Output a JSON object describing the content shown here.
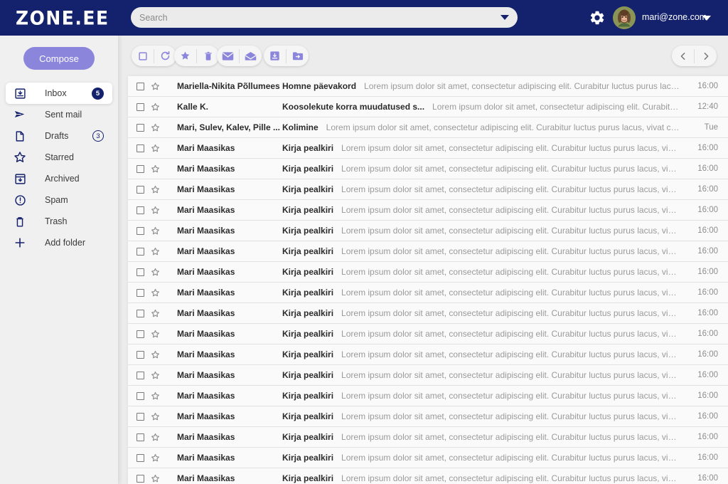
{
  "brand": {
    "logo_text": "ZONE.EE",
    "navy": "#14216d",
    "purple": "#8b85dc"
  },
  "search": {
    "placeholder": "Search",
    "value": "",
    "dropdown_icon": "chevron-down-icon"
  },
  "account": {
    "gear_icon": "gear-icon",
    "avatar_icon": "user-avatar",
    "email": "mari@zone.com",
    "caret_icon": "chevron-down-icon"
  },
  "sidebar": {
    "compose_label": "Compose",
    "items": [
      {
        "label": "Inbox",
        "icon": "inbox-icon",
        "badge": "5",
        "badge_style": "filled",
        "active": true
      },
      {
        "label": "Sent mail",
        "icon": "send-icon",
        "badge": "",
        "badge_style": "none",
        "active": false
      },
      {
        "label": "Drafts",
        "icon": "document-icon",
        "badge": "3",
        "badge_style": "outline",
        "active": false
      },
      {
        "label": "Starred",
        "icon": "star-icon",
        "badge": "",
        "badge_style": "none",
        "active": false
      },
      {
        "label": "Archived",
        "icon": "archive-icon",
        "badge": "",
        "badge_style": "none",
        "active": false
      },
      {
        "label": "Spam",
        "icon": "alert-icon",
        "badge": "",
        "badge_style": "none",
        "active": false
      },
      {
        "label": "Trash",
        "icon": "trash-icon",
        "badge": "",
        "badge_style": "none",
        "active": false
      },
      {
        "label": "Add folder",
        "icon": "plus-icon",
        "badge": "",
        "badge_style": "none",
        "active": false
      }
    ]
  },
  "toolbar": {
    "groups": [
      {
        "name": "selection-group",
        "buttons": [
          {
            "icon": "checkbox-icon",
            "label": "Select all"
          },
          {
            "icon": "refresh-icon",
            "label": "Refresh"
          }
        ]
      },
      {
        "name": "mark-group",
        "buttons": [
          {
            "icon": "star-icon",
            "label": "Star"
          },
          {
            "icon": "trash-icon",
            "label": "Delete"
          }
        ]
      },
      {
        "name": "read-group",
        "buttons": [
          {
            "icon": "envelope-closed-icon",
            "label": "Mark as read"
          },
          {
            "icon": "envelope-open-icon",
            "label": "Mark as unread"
          }
        ]
      },
      {
        "name": "move-group",
        "buttons": [
          {
            "icon": "archive-icon",
            "label": "Archive"
          },
          {
            "icon": "folder-move-icon",
            "label": "Move to folder"
          }
        ]
      }
    ],
    "pager": [
      {
        "icon": "chevron-left-icon",
        "label": "Previous page"
      },
      {
        "icon": "chevron-right-icon",
        "label": "Next page"
      }
    ]
  },
  "mail_list": {
    "rows": [
      {
        "sender": "Mariella-Nikita Põllumees",
        "subject": "Homne päevakord",
        "preview": "Lorem ipsum dolor sit amet, consectetur adipiscing elit. Curabitur luctus purus lacus, vivat crescendo maris dolor sit amet consectetur.",
        "time": "16:00"
      },
      {
        "sender": "Kalle K.",
        "subject": "Koosolekute korra muudatused s...",
        "preview": "Lorem ipsum dolor sit amet, consectetur adipiscing elit. Curabitur luctus purus lacus, vivat crescendo maris dolor.",
        "time": "12:40"
      },
      {
        "sender": "Mari, Sulev, Kalev, Pille ...",
        "subject": "Kolimine",
        "preview": "Lorem ipsum dolor sit amet, consectetur adipiscing elit. Curabitur luctus purus lacus, vivat crescendo maris dolor sit amet.",
        "time": "Tue"
      },
      {
        "sender": "Mari Maasikas",
        "subject": "Kirja pealkiri",
        "preview": "Lorem ipsum dolor sit amet, consectetur adipiscing elit. Curabitur luctus purus lacus, vivat crescendo maris dolor.",
        "time": "16:00"
      },
      {
        "sender": "Mari Maasikas",
        "subject": "Kirja pealkiri",
        "preview": "Lorem ipsum dolor sit amet, consectetur adipiscing elit. Curabitur luctus purus lacus, vivat crescendo maris dolor.",
        "time": "16:00"
      },
      {
        "sender": "Mari Maasikas",
        "subject": "Kirja pealkiri",
        "preview": "Lorem ipsum dolor sit amet, consectetur adipiscing elit. Curabitur luctus purus lacus, vivat crescendo maris dolor.",
        "time": "16:00"
      },
      {
        "sender": "Mari Maasikas",
        "subject": "Kirja pealkiri",
        "preview": "Lorem ipsum dolor sit amet, consectetur adipiscing elit. Curabitur luctus purus lacus, vivat crescendo maris dolor.",
        "time": "16:00"
      },
      {
        "sender": "Mari Maasikas",
        "subject": "Kirja pealkiri",
        "preview": "Lorem ipsum dolor sit amet, consectetur adipiscing elit. Curabitur luctus purus lacus, vivat crescendo maris dolor.",
        "time": "16:00"
      },
      {
        "sender": "Mari Maasikas",
        "subject": "Kirja pealkiri",
        "preview": "Lorem ipsum dolor sit amet, consectetur adipiscing elit. Curabitur luctus purus lacus, vivat crescendo maris dolor.",
        "time": "16:00"
      },
      {
        "sender": "Mari Maasikas",
        "subject": "Kirja pealkiri",
        "preview": "Lorem ipsum dolor sit amet, consectetur adipiscing elit. Curabitur luctus purus lacus, vivat crescendo maris dolor.",
        "time": "16:00"
      },
      {
        "sender": "Mari Maasikas",
        "subject": "Kirja pealkiri",
        "preview": "Lorem ipsum dolor sit amet, consectetur adipiscing elit. Curabitur luctus purus lacus, vivat crescendo maris dolor.",
        "time": "16:00"
      },
      {
        "sender": "Mari Maasikas",
        "subject": "Kirja pealkiri",
        "preview": "Lorem ipsum dolor sit amet, consectetur adipiscing elit. Curabitur luctus purus lacus, vivat crescendo maris dolor.",
        "time": "16:00"
      },
      {
        "sender": "Mari Maasikas",
        "subject": "Kirja pealkiri",
        "preview": "Lorem ipsum dolor sit amet, consectetur adipiscing elit. Curabitur luctus purus lacus, vivat crescendo maris dolor.",
        "time": "16:00"
      },
      {
        "sender": "Mari Maasikas",
        "subject": "Kirja pealkiri",
        "preview": "Lorem ipsum dolor sit amet, consectetur adipiscing elit. Curabitur luctus purus lacus, vivat crescendo maris dolor.",
        "time": "16:00"
      },
      {
        "sender": "Mari Maasikas",
        "subject": "Kirja pealkiri",
        "preview": "Lorem ipsum dolor sit amet, consectetur adipiscing elit. Curabitur luctus purus lacus, vivat crescendo maris dolor.",
        "time": "16:00"
      },
      {
        "sender": "Mari Maasikas",
        "subject": "Kirja pealkiri",
        "preview": "Lorem ipsum dolor sit amet, consectetur adipiscing elit. Curabitur luctus purus lacus, vivat crescendo maris dolor.",
        "time": "16:00"
      },
      {
        "sender": "Mari Maasikas",
        "subject": "Kirja pealkiri",
        "preview": "Lorem ipsum dolor sit amet, consectetur adipiscing elit. Curabitur luctus purus lacus, vivat crescendo maris dolor.",
        "time": "16:00"
      },
      {
        "sender": "Mari Maasikas",
        "subject": "Kirja pealkiri",
        "preview": "Lorem ipsum dolor sit amet, consectetur adipiscing elit. Curabitur luctus purus lacus, vivat crescendo maris dolor.",
        "time": "16:00"
      },
      {
        "sender": "Mari Maasikas",
        "subject": "Kirja pealkiri",
        "preview": "Lorem ipsum dolor sit amet, consectetur adipiscing elit. Curabitur luctus purus lacus, vivat crescendo maris dolor.",
        "time": "16:00"
      },
      {
        "sender": "Mari Maasikas",
        "subject": "Kirja pealkiri",
        "preview": "Lorem ipsum dolor sit amet, consectetur adipiscing elit. Curabitur luctus purus lacus, vivat crescendo maris dolor.",
        "time": "16:00"
      }
    ]
  }
}
